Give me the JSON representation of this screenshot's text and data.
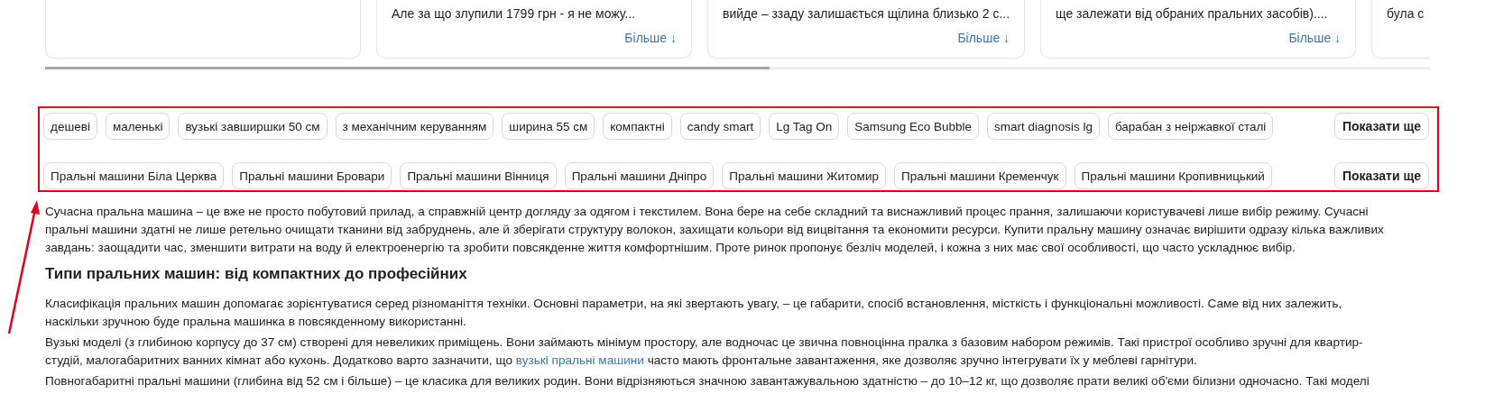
{
  "review_cards": [
    {
      "kind": "empty"
    },
    {
      "kind": "review",
      "lines": [
        "Але за що злупили 1799 грн - я не можу..."
      ],
      "more": "Більше ↓"
    },
    {
      "kind": "review",
      "lines": [
        "вийде – ззаду залишається щілина близько 2 с..."
      ],
      "more": "Більше ↓"
    },
    {
      "kind": "review",
      "lines": [
        "ще залежати від обраних пральних засобів)...."
      ],
      "more": "Більше ↓"
    },
    {
      "kind": "review",
      "lines": [
        "була с"
      ]
    }
  ],
  "tag_rows": [
    {
      "tags": [
        "дешеві",
        "маленькі",
        "вузькі завширшки 50 см",
        "з механічним керуванням",
        "ширина 55 см",
        "компактні",
        "candy smart",
        "Lg Tag On",
        "Samsung Eco Bubble",
        "smart diagnosis lg",
        "барабан з неіржавкої сталі"
      ],
      "show_more": "Показати ще"
    },
    {
      "tags": [
        "Пральні машини Біла Церква",
        "Пральні машини Бровари",
        "Пральні машини Вінниця",
        "Пральні машини Дніпро",
        "Пральні машини Житомир",
        "Пральні машини Кременчук",
        "Пральні машини Кропивницький"
      ],
      "show_more": "Показати ще"
    }
  ],
  "article": [
    {
      "kind": "paragraph",
      "segments": [
        {
          "kind": "text",
          "text": "Сучасна пральна машина – це вже не просто побутовий прилад, а справжній центр догляду за одягом і текстилем. Вона бере на себе складний та виснажливий процес прання, залишаючи користувачеві лише вибір режиму. Сучасні пральні машини здатні не лише ретельно очищати тканини від забруднень, але й зберігати структуру волокон, захищати кольори від вицвітання та економити ресурси. Купити пральну машину означає вирішити одразу кілька важливих завдань: заощадити час, зменшити витрати на воду й електроенергію та зробити повсякденне життя комфортнішим. Проте ринок пропонує безліч моделей, і кожна з них має свої особливості, що часто ускладнює вибір."
        }
      ]
    },
    {
      "kind": "heading",
      "text": "Типи пральних машин: від компактних до професійних"
    },
    {
      "kind": "paragraph",
      "segments": [
        {
          "kind": "text",
          "text": "Класифікація пральних машин допомагає зорієнтуватися серед різноманіття техніки. Основні параметри, на які звертають увагу, – це габарити, спосіб встановлення, місткість і функціональні можливості. Саме від них залежить, наскільки зручною буде пральна машинка в повсякденному використанні."
        }
      ]
    },
    {
      "kind": "paragraph",
      "segments": [
        {
          "kind": "text",
          "text": "Вузькі моделі (з глибиною корпусу до 37 см) створені для невеликих приміщень. Вони займають мінімум простору, але водночас це звична повноцінна пралка з базовим набором режимів. Такі пристрої особливо зручні для квартир-студій, малогабаритних ванних кімнат або кухонь. Додатково варто зазначити, що "
        },
        {
          "kind": "link",
          "text": "вузькі пральні машини"
        },
        {
          "kind": "text",
          "text": " часто мають фронтальне завантаження, яке дозволяє зручно інтегрувати їх у меблеві гарнітури."
        }
      ]
    },
    {
      "kind": "paragraph",
      "segments": [
        {
          "kind": "text",
          "text": "Повногабаритні пральні машини (глибина від 52 см і більше) – це класика для великих родин. Вони відрізняються значною завантажувальною здатністю – до 10–12 кг, що дозволяє прати великі об'єми білизни одночасно. Такі моделі"
        }
      ]
    }
  ]
}
